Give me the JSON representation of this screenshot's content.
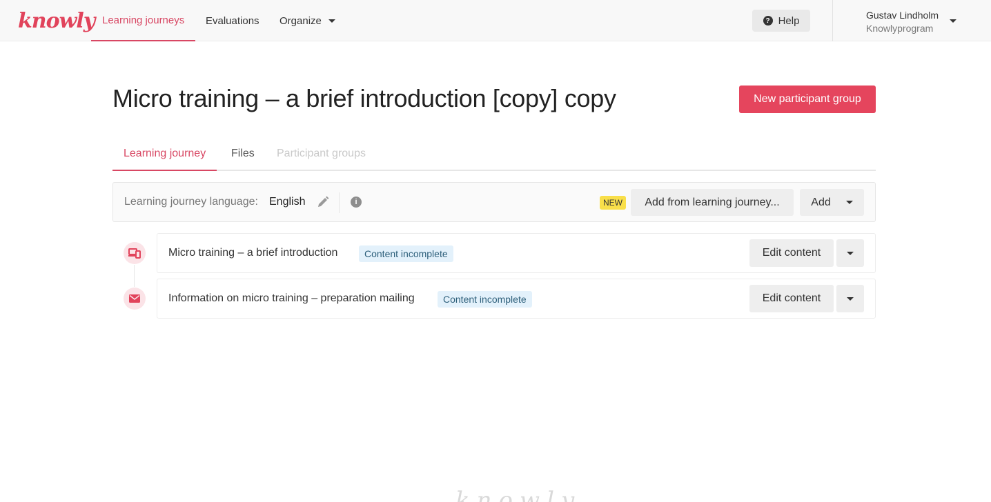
{
  "app": {
    "logo_text": "knowly",
    "brand_color": "#e5455d"
  },
  "nav": {
    "items": [
      {
        "label": "Learning journeys",
        "active": true
      },
      {
        "label": "Evaluations",
        "active": false
      },
      {
        "label": "Organize",
        "active": false,
        "has_dropdown": true
      }
    ],
    "help_label": "Help",
    "help_icon": "question-circle-icon"
  },
  "user": {
    "name": "Gustav Lindholm",
    "organization": "Knowlyprogram"
  },
  "page": {
    "title": "Micro training – a brief introduction [copy] copy",
    "primary_action": "New participant group"
  },
  "tabs": [
    {
      "label": "Learning journey",
      "state": "active"
    },
    {
      "label": "Files",
      "state": "normal"
    },
    {
      "label": "Participant groups",
      "state": "disabled"
    }
  ],
  "toolbar": {
    "language_label": "Learning journey language:",
    "language_value": "English",
    "new_badge": "NEW",
    "add_from_label": "Add from learning journey...",
    "add_label": "Add"
  },
  "items": [
    {
      "icon": "devices-icon",
      "title": "Micro training – a brief introduction",
      "status": "Content incomplete",
      "edit_label": "Edit content"
    },
    {
      "icon": "envelope-icon",
      "title": "Information on micro training – preparation mailing",
      "status": "Content incomplete",
      "edit_label": "Edit content"
    }
  ],
  "footer": {
    "logo_text": "knowly"
  }
}
